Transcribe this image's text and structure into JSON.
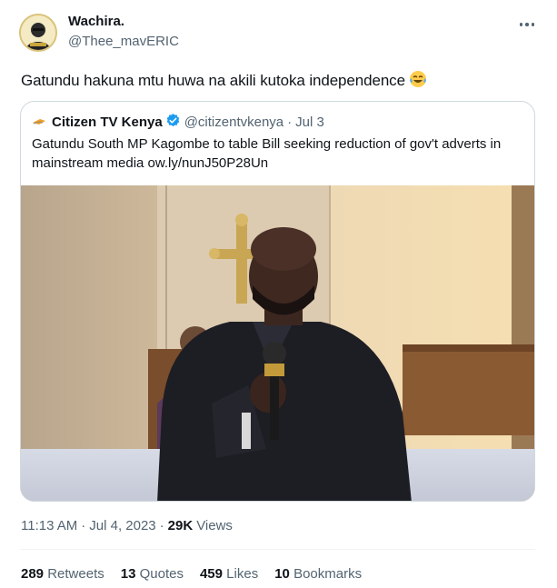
{
  "author": {
    "display_name": "Wachira.",
    "handle": "@Thee_mavERIC",
    "avatar_icon": "portrait-avatar"
  },
  "tweet": {
    "text": "Gatundu hakuna mtu huwa na akili kutoka independence",
    "emoji": "face-with-tears-of-joy"
  },
  "quoted": {
    "name": "Citizen TV Kenya",
    "handle": "@citizentvkenya",
    "separator": "·",
    "date": "Jul 3",
    "text": "Gatundu South MP Kagombe to table Bill seeking reduction of gov't adverts in mainstream media ow.ly/nunJ50P28Un",
    "verified_color": "#1d9bf0"
  },
  "meta": {
    "time": "11:13 AM",
    "separator1": "·",
    "date": "Jul 4, 2023",
    "separator2": "·",
    "views_count": "29K",
    "views_label": "Views"
  },
  "stats": [
    {
      "count": "289",
      "label": "Retweets"
    },
    {
      "count": "13",
      "label": "Quotes"
    },
    {
      "count": "459",
      "label": "Likes"
    },
    {
      "count": "10",
      "label": "Bookmarks"
    }
  ],
  "colors": {
    "text": "#0f1419",
    "secondary": "#536471",
    "border": "#cfd9de",
    "verified": "#1d9bf0"
  }
}
